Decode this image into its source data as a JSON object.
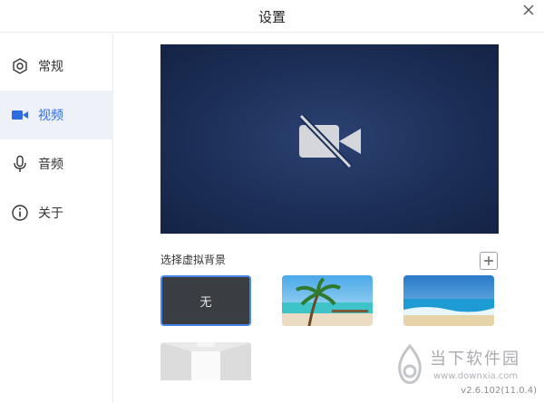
{
  "window": {
    "title": "设置"
  },
  "sidebar": {
    "items": [
      {
        "label": "常规",
        "icon": "hexagon-gear-icon",
        "active": false
      },
      {
        "label": "视频",
        "icon": "video-camera-icon",
        "active": true
      },
      {
        "label": "音频",
        "icon": "microphone-icon",
        "active": false
      },
      {
        "label": "关于",
        "icon": "info-icon",
        "active": false
      }
    ]
  },
  "video": {
    "preview_icon": "camera-off-icon",
    "background_label": "选择虚拟背景",
    "backgrounds": [
      {
        "label": "无",
        "selected": true
      },
      {
        "label": "",
        "kind": "beach-palm"
      },
      {
        "label": "",
        "kind": "beach-waves"
      },
      {
        "label": "",
        "kind": "white-room"
      }
    ]
  },
  "watermark": {
    "brand": "当下软件园",
    "url": "www.downxia.com"
  },
  "version": "v2.6.102(11.0.4)",
  "colors": {
    "accent": "#2d6cdf",
    "preview_bg": "#1c2f57",
    "selected_border": "#4a86e8"
  }
}
